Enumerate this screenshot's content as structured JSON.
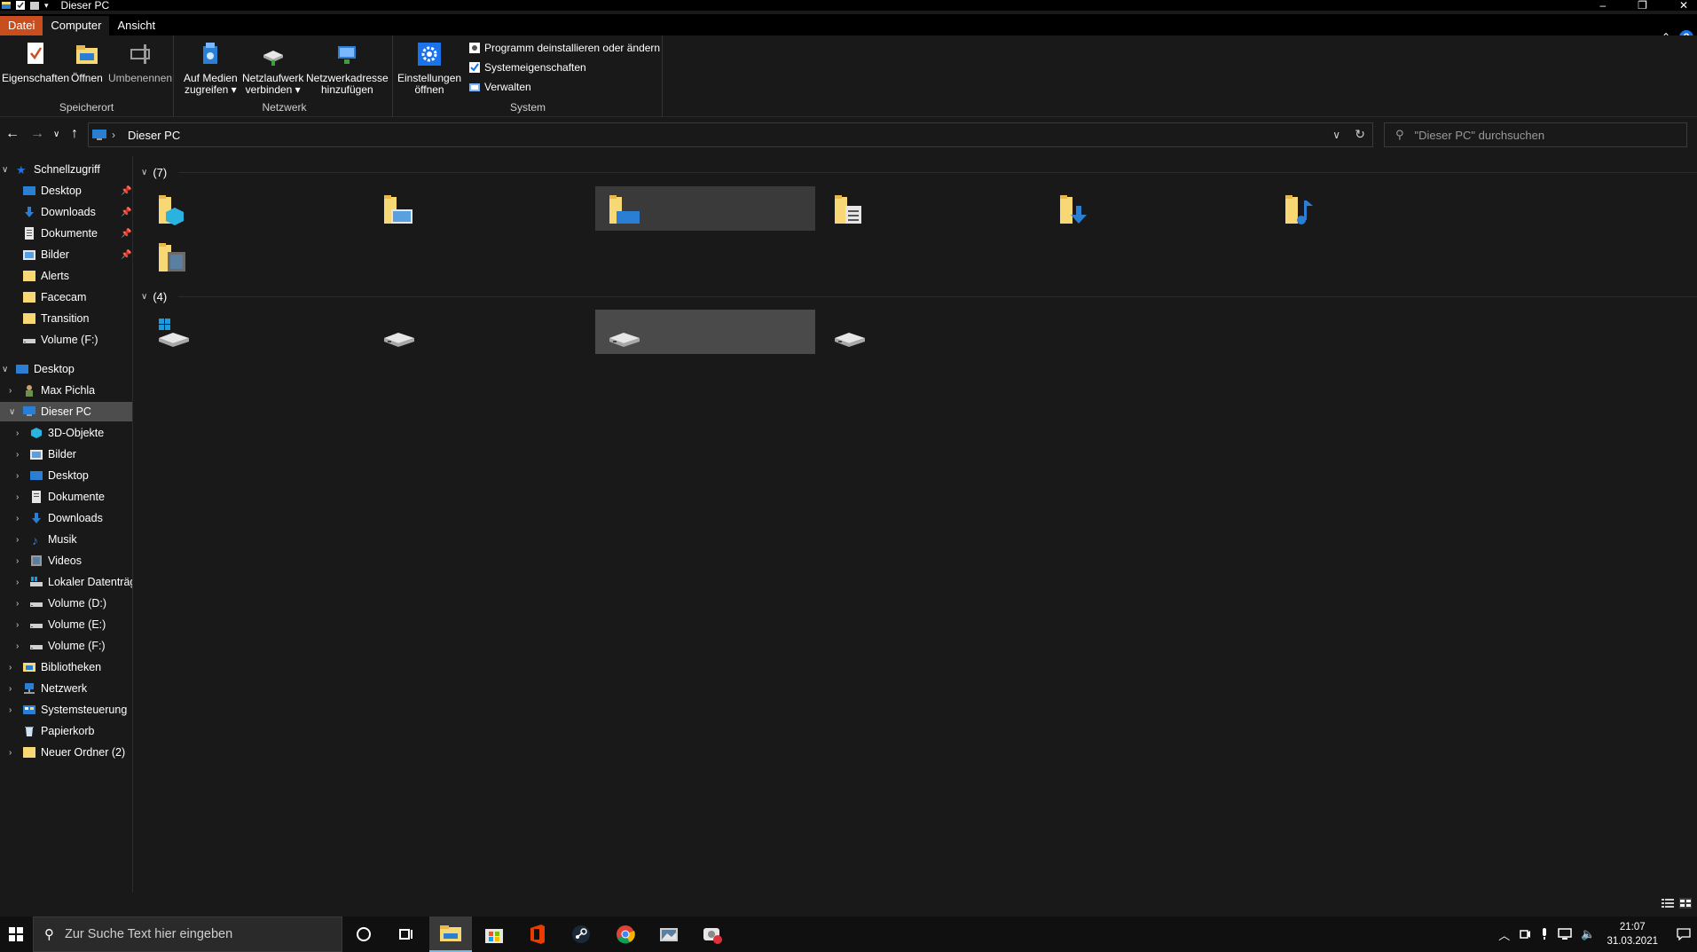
{
  "window": {
    "title": "Dieser PC",
    "controls": {
      "minimize": "–",
      "maximize": "❐",
      "close": "✕"
    }
  },
  "ribbon_tabs": [
    {
      "label": "Datei"
    },
    {
      "label": "Computer"
    },
    {
      "label": "Ansicht"
    }
  ],
  "ribbon": {
    "groups": {
      "speicherort": {
        "label": "Speicherort",
        "buttons": [
          {
            "label_line1": "Eigenschaften",
            "label_line2": "",
            "icon": "properties-icon"
          },
          {
            "label_line1": "Öffnen",
            "label_line2": "",
            "icon": "open-folder-icon"
          },
          {
            "label_line1": "Umbenennen",
            "label_line2": "",
            "icon": "rename-icon"
          }
        ]
      },
      "netzwerk": {
        "label": "Netzwerk",
        "buttons": [
          {
            "label_line1": "Auf Medien",
            "label_line2": "zugreifen ▾",
            "icon": "media-access-icon"
          },
          {
            "label_line1": "Netzlaufwerk",
            "label_line2": "verbinden ▾",
            "icon": "network-drive-icon"
          },
          {
            "label_line1": "Netzwerkadresse",
            "label_line2": "hinzufügen",
            "icon": "network-location-icon"
          }
        ]
      },
      "system": {
        "label": "System",
        "big_button": {
          "label_line1": "Einstellungen",
          "label_line2": "öffnen",
          "icon": "settings-gear-icon"
        },
        "small_buttons": [
          {
            "label": "Programm deinstallieren oder ändern",
            "icon": "uninstall-icon"
          },
          {
            "label": "Systemeigenschaften",
            "icon": "system-properties-icon"
          },
          {
            "label": "Verwalten",
            "icon": "manage-icon"
          }
        ]
      }
    }
  },
  "address": {
    "breadcrumb": "Dieser PC",
    "search_placeholder": "\"Dieser PC\" durchsuchen"
  },
  "sidebar": {
    "quick_access": {
      "label": "Schnellzugriff",
      "items": [
        {
          "label": "Desktop",
          "pinned": true,
          "icon": "desktop-folder-icon"
        },
        {
          "label": "Downloads",
          "pinned": true,
          "icon": "downloads-icon"
        },
        {
          "label": "Dokumente",
          "pinned": true,
          "icon": "documents-icon"
        },
        {
          "label": "Bilder",
          "pinned": true,
          "icon": "pictures-icon"
        },
        {
          "label": "Alerts",
          "pinned": false,
          "icon": "folder-icon"
        },
        {
          "label": "Facecam",
          "pinned": false,
          "icon": "folder-icon"
        },
        {
          "label": "Transition",
          "pinned": false,
          "icon": "folder-icon"
        },
        {
          "label": "Volume (F:)",
          "pinned": false,
          "icon": "drive-icon"
        }
      ]
    },
    "desktop": {
      "label": "Desktop",
      "items": [
        {
          "label": "Max Pichla",
          "icon": "user-folder-icon"
        },
        {
          "label": "Dieser PC",
          "icon": "this-pc-icon",
          "selected": true
        },
        {
          "label": "Bibliotheken",
          "icon": "libraries-icon"
        },
        {
          "label": "Netzwerk",
          "icon": "network-icon"
        },
        {
          "label": "Systemsteuerung",
          "icon": "control-panel-icon"
        },
        {
          "label": "Papierkorb",
          "icon": "recycle-bin-icon"
        },
        {
          "label": "Neuer Ordner (2)",
          "icon": "folder-icon"
        }
      ]
    },
    "this_pc_children": [
      {
        "label": "3D-Objekte",
        "icon": "3d-objects-icon"
      },
      {
        "label": "Bilder",
        "icon": "pictures-icon"
      },
      {
        "label": "Desktop",
        "icon": "desktop-folder-icon"
      },
      {
        "label": "Dokumente",
        "icon": "documents-icon"
      },
      {
        "label": "Downloads",
        "icon": "downloads-icon"
      },
      {
        "label": "Musik",
        "icon": "music-icon"
      },
      {
        "label": "Videos",
        "icon": "videos-icon"
      },
      {
        "label": "Lokaler Datenträg",
        "icon": "local-disk-icon"
      },
      {
        "label": "Volume (D:)",
        "icon": "drive-icon"
      },
      {
        "label": "Volume (E:)",
        "icon": "drive-icon"
      },
      {
        "label": "Volume (F:)",
        "icon": "drive-icon"
      }
    ]
  },
  "content": {
    "folders_group": {
      "count_label": "(7)"
    },
    "drives_group": {
      "count_label": "(4)"
    },
    "folders": [
      {
        "icon": "3d-objects-folder-icon"
      },
      {
        "icon": "pictures-folder-icon"
      },
      {
        "icon": "desktop-folder-icon"
      },
      {
        "icon": "documents-folder-icon"
      },
      {
        "icon": "downloads-folder-icon"
      },
      {
        "icon": "music-folder-icon"
      },
      {
        "icon": "videos-folder-icon"
      }
    ],
    "drives": [
      {
        "icon": "windows-drive-icon"
      },
      {
        "icon": "drive-icon"
      },
      {
        "icon": "drive-icon"
      },
      {
        "icon": "drive-icon"
      }
    ]
  },
  "taskbar": {
    "search_placeholder": "Zur Suche Text hier eingeben",
    "apps": [
      {
        "name": "cortana"
      },
      {
        "name": "task-view"
      },
      {
        "name": "file-explorer",
        "active": true
      },
      {
        "name": "microsoft-store"
      },
      {
        "name": "office"
      },
      {
        "name": "steam"
      },
      {
        "name": "chrome"
      },
      {
        "name": "photos"
      },
      {
        "name": "camera-app"
      }
    ],
    "clock": {
      "time": "21:07",
      "date": "31.03.2021"
    }
  },
  "colors": {
    "file_tab": "#c94e1e",
    "accent_blue": "#1a73e8",
    "folder_yellow": "#f8d775",
    "background": "#191919",
    "selected_bg": "#4d4d4d"
  }
}
